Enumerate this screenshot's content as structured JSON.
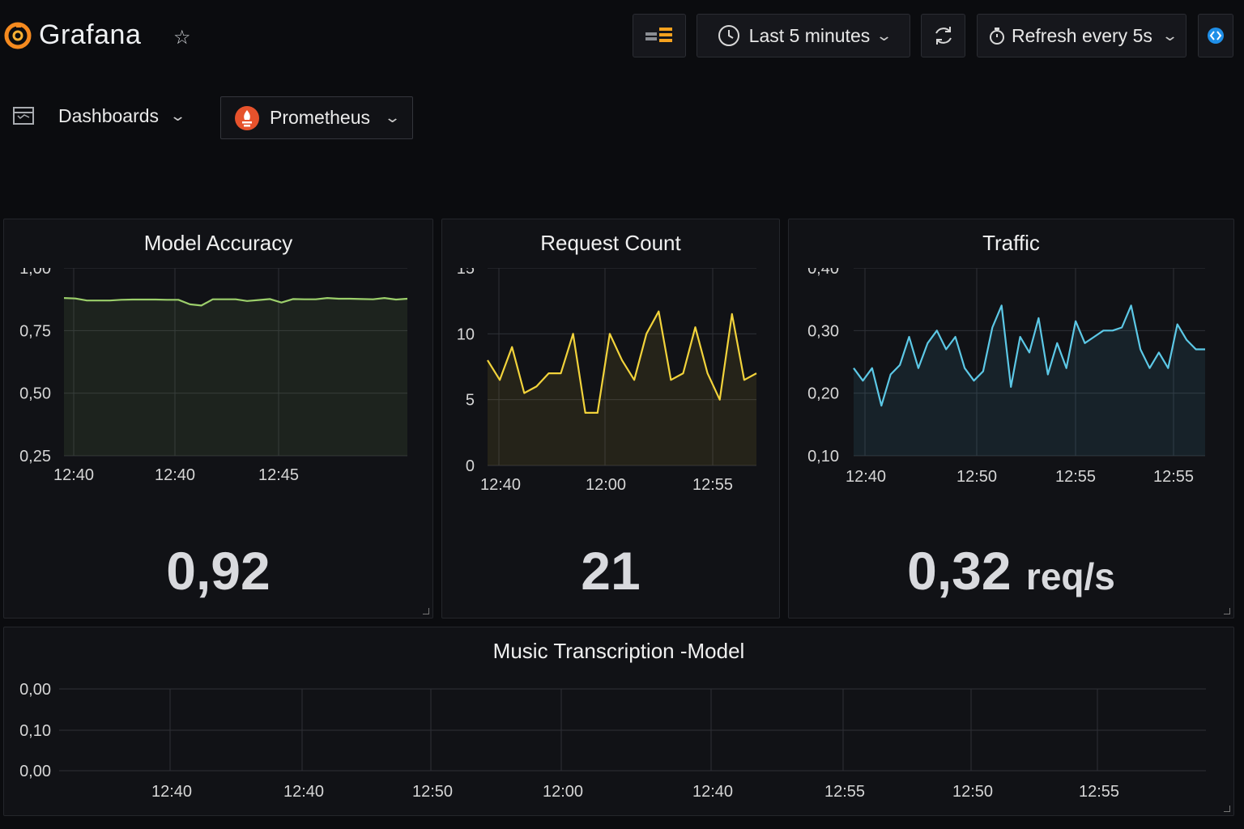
{
  "app": {
    "name": "Grafana"
  },
  "toolbar": {
    "time_range_label": "Last 5 minutes",
    "refresh_label": "Refresh every 5s"
  },
  "nav": {
    "dashboards_label": "Dashboards",
    "datasource_label": "Prometheus"
  },
  "colors": {
    "accuracy": "#9ccf6b",
    "requests": "#f2d33b",
    "traffic": "#5cc8e6",
    "grafana_orange": "#f58a1f",
    "prometheus_red": "#e6522c"
  },
  "panels": {
    "accuracy": {
      "title": "Model Accuracy",
      "value": "0,92"
    },
    "requests": {
      "title": "Request Count",
      "value": "21"
    },
    "traffic": {
      "title": "Traffic",
      "value": "0,32",
      "unit": "req/s"
    },
    "music": {
      "title": "Music Transcription -Model"
    }
  },
  "chart_data": [
    {
      "id": "accuracy",
      "type": "line",
      "title": "Model Accuracy",
      "ylim": [
        0.25,
        1.0
      ],
      "yticks": [
        "1,00",
        "0,75",
        "0,50",
        "0,25"
      ],
      "xticks": [
        "12:40",
        "12:40",
        "12:45"
      ],
      "grid": true,
      "values": [
        0.88,
        0.878,
        0.87,
        0.87,
        0.87,
        0.873,
        0.874,
        0.874,
        0.874,
        0.873,
        0.873,
        0.855,
        0.85,
        0.875,
        0.875,
        0.875,
        0.868,
        0.872,
        0.876,
        0.862,
        0.876,
        0.875,
        0.875,
        0.88,
        0.877,
        0.877,
        0.876,
        0.875,
        0.88,
        0.874,
        0.877
      ]
    },
    {
      "id": "requests",
      "type": "line",
      "title": "Request Count",
      "ylim": [
        0,
        15
      ],
      "yticks": [
        "15",
        "10",
        "5",
        "0"
      ],
      "xticks": [
        "12:40",
        "12:00",
        "12:55"
      ],
      "grid": true,
      "values": [
        8,
        6.5,
        9,
        5.5,
        6,
        7,
        7,
        10,
        4,
        4,
        10,
        8,
        6.5,
        10,
        11.7,
        6.5,
        7,
        10.5,
        7,
        5,
        11.5,
        6.5,
        7
      ]
    },
    {
      "id": "traffic",
      "type": "line",
      "title": "Traffic",
      "ylim": [
        0.1,
        0.4
      ],
      "yticks": [
        "0,40",
        "0,30",
        "0,20",
        "0,10"
      ],
      "xticks": [
        "12:40",
        "12:50",
        "12:55",
        "12:55"
      ],
      "grid": true,
      "values": [
        0.24,
        0.22,
        0.24,
        0.18,
        0.23,
        0.245,
        0.29,
        0.24,
        0.28,
        0.3,
        0.27,
        0.29,
        0.24,
        0.22,
        0.235,
        0.305,
        0.34,
        0.21,
        0.29,
        0.265,
        0.32,
        0.23,
        0.28,
        0.24,
        0.315,
        0.28,
        0.29,
        0.3,
        0.3,
        0.305,
        0.34,
        0.27,
        0.24,
        0.265,
        0.24,
        0.31,
        0.285,
        0.27,
        0.27
      ]
    },
    {
      "id": "music",
      "type": "line",
      "title": "Music Transcription -Model",
      "yticks": [
        "0,00",
        "0,10",
        "0,00"
      ],
      "xticks": [
        "12:40",
        "12:40",
        "12:50",
        "12:00",
        "12:40",
        "12:55",
        "12:50",
        "12:55"
      ],
      "grid": true,
      "values": []
    }
  ]
}
